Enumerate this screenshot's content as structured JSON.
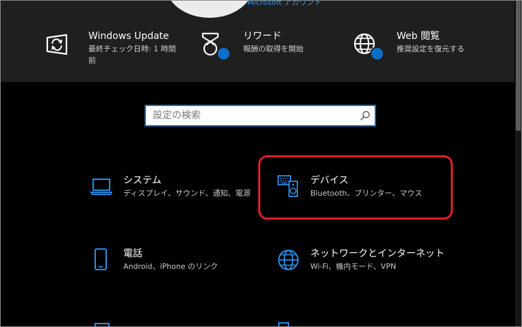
{
  "header": {
    "account_link": "Microsoft アカウント",
    "tiles": [
      {
        "title": "Windows Update",
        "sub": "最終チェック日時: 1 時間前",
        "icon": "windows-update-icon"
      },
      {
        "title": "リワード",
        "sub": "報酬の取得を開始",
        "icon": "rewards-medal-icon"
      },
      {
        "title": "Web 閲覧",
        "sub": "推奨設定を復元する",
        "icon": "globe-icon"
      }
    ]
  },
  "search": {
    "placeholder": "設定の検索"
  },
  "categories": [
    {
      "title": "システム",
      "sub": "ディスプレイ、サウンド、通知、電源",
      "icon": "laptop-icon"
    },
    {
      "title": "デバイス",
      "sub": "Bluetooth、プリンター、マウス",
      "icon": "keyboard-speaker-icon"
    },
    {
      "title": "電話",
      "sub": "Android、iPhone のリンク",
      "icon": "phone-icon"
    },
    {
      "title": "ネットワークとインターネット",
      "sub": "Wi-Fi、機内モード、VPN",
      "icon": "globe-icon"
    }
  ],
  "colors": {
    "accent": "#0f6cbd",
    "icon_blue": "#2a8fe8",
    "highlight": "#e01e2a",
    "header_bg": "#1f1f1f",
    "page_bg": "#000000"
  }
}
